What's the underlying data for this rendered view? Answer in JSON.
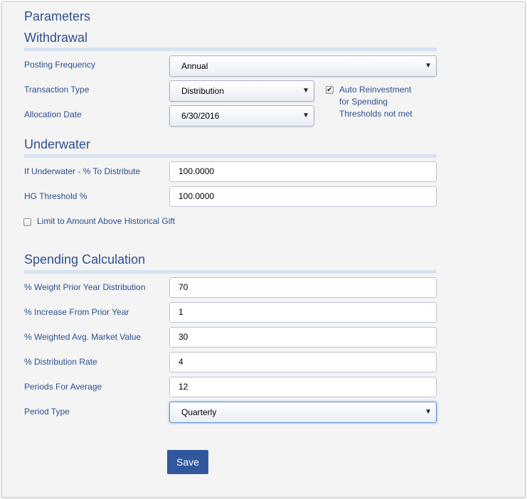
{
  "page_title": "Parameters",
  "withdrawal": {
    "title": "Withdrawal",
    "posting_frequency": {
      "label": "Posting Frequency",
      "value": "Annual"
    },
    "transaction_type": {
      "label": "Transaction Type",
      "value": "Distribution"
    },
    "allocation_date": {
      "label": "Allocation Date",
      "value": "6/30/2016"
    },
    "auto_reinvestment": {
      "checked": true,
      "label_lines": [
        "Auto Reinvestment",
        "for Spending",
        "Thresholds not met"
      ]
    }
  },
  "underwater": {
    "title": "Underwater",
    "pct_to_distribute": {
      "label": "If Underwater - % To Distribute",
      "value": "100.0000"
    },
    "hg_threshold": {
      "label": "HG Threshold %",
      "value": "100.0000"
    },
    "limit_above_gift": {
      "checked": false,
      "label": "Limit to Amount Above Historical Gift"
    }
  },
  "spending": {
    "title": "Spending Calculation",
    "weight_prior_year": {
      "label": "% Weight Prior Year Distribution",
      "value": "70"
    },
    "increase_prior_year": {
      "label": "% Increase From Prior Year",
      "value": "1"
    },
    "weighted_avg_market": {
      "label": "% Weighted Avg. Market Value",
      "value": "30"
    },
    "distribution_rate": {
      "label": "% Distribution Rate",
      "value": "4"
    },
    "periods_for_average": {
      "label": "Periods For Average",
      "value": "12"
    },
    "period_type": {
      "label": "Period Type",
      "value": "Quarterly"
    }
  },
  "save_label": "Save",
  "colors": {
    "accent": "#2e4f8e",
    "button": "#31589e",
    "rule": "#d7e3f2"
  }
}
